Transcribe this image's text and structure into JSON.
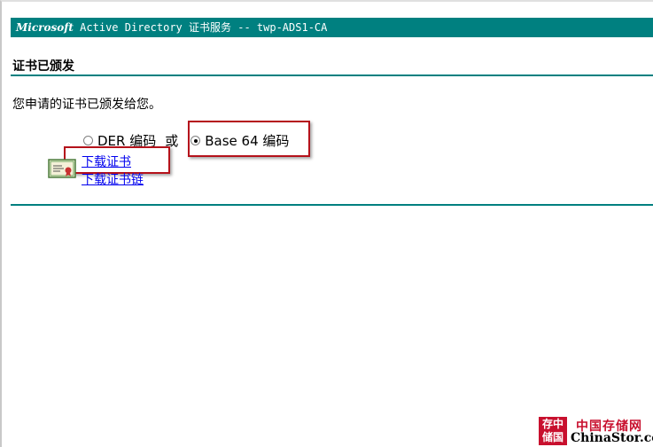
{
  "header": {
    "brand": "Microsoft",
    "title_rest": " Active Directory 证书服务  --  twp-ADS1-CA"
  },
  "page_title": "证书已颁发",
  "message": "您申请的证书已颁发给您。",
  "encoding": {
    "option_der": "DER 编码",
    "or_text": "或",
    "option_base64": "Base 64 编码",
    "selected": "Base 64 编码"
  },
  "links": {
    "download_cert": "下载证书",
    "download_chain": "下载证书链"
  },
  "watermark": {
    "logo_line1": "存中",
    "logo_line2": "储国",
    "cn_text": "中国存储网",
    "en_text": "ChinaStor.com"
  },
  "colors": {
    "teal": "#008080",
    "highlight_red": "#b5121b",
    "link_blue": "#0000ee"
  }
}
